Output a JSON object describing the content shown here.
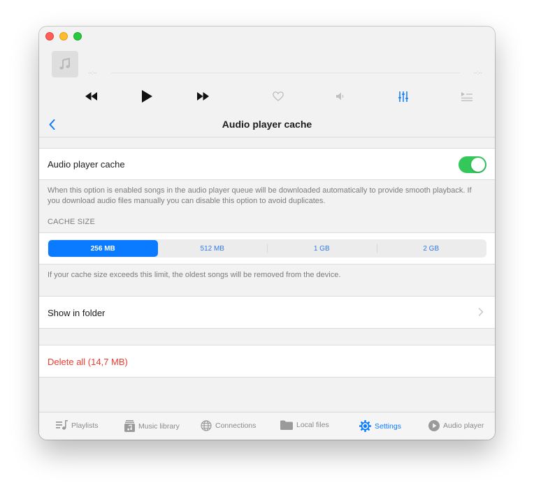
{
  "player": {
    "elapsed": "--:--",
    "remaining": "--:--"
  },
  "nav": {
    "title": "Audio player cache"
  },
  "cache_toggle": {
    "label": "Audio player cache",
    "enabled": true
  },
  "description": "When this option is enabled songs in the audio player queue will be downloaded automatically to provide smooth playback. If you download audio files manually you can disable this option to avoid duplicates.",
  "cache_size": {
    "header": "CACHE SIZE",
    "options": [
      "256 MB",
      "512 MB",
      "1 GB",
      "2 GB"
    ],
    "selected": "256 MB",
    "footnote": "If your cache size exceeds this limit, the oldest songs will be removed from the device."
  },
  "show_in_folder": {
    "label": "Show in folder"
  },
  "delete_all": {
    "label": "Delete all (14,7 MB)"
  },
  "tabs": [
    {
      "label": "Playlists",
      "icon": "playlists-icon"
    },
    {
      "label": "Music library",
      "icon": "music-library-icon"
    },
    {
      "label": "Connections",
      "icon": "globe-icon"
    },
    {
      "label": "Local files",
      "icon": "folder-icon"
    },
    {
      "label": "Settings",
      "icon": "gear-icon",
      "active": true
    },
    {
      "label": "Audio player",
      "icon": "play-circle-icon"
    }
  ],
  "colors": {
    "accent": "#0a7bff",
    "toggle_on": "#34c759",
    "destructive": "#ef3b2f"
  }
}
